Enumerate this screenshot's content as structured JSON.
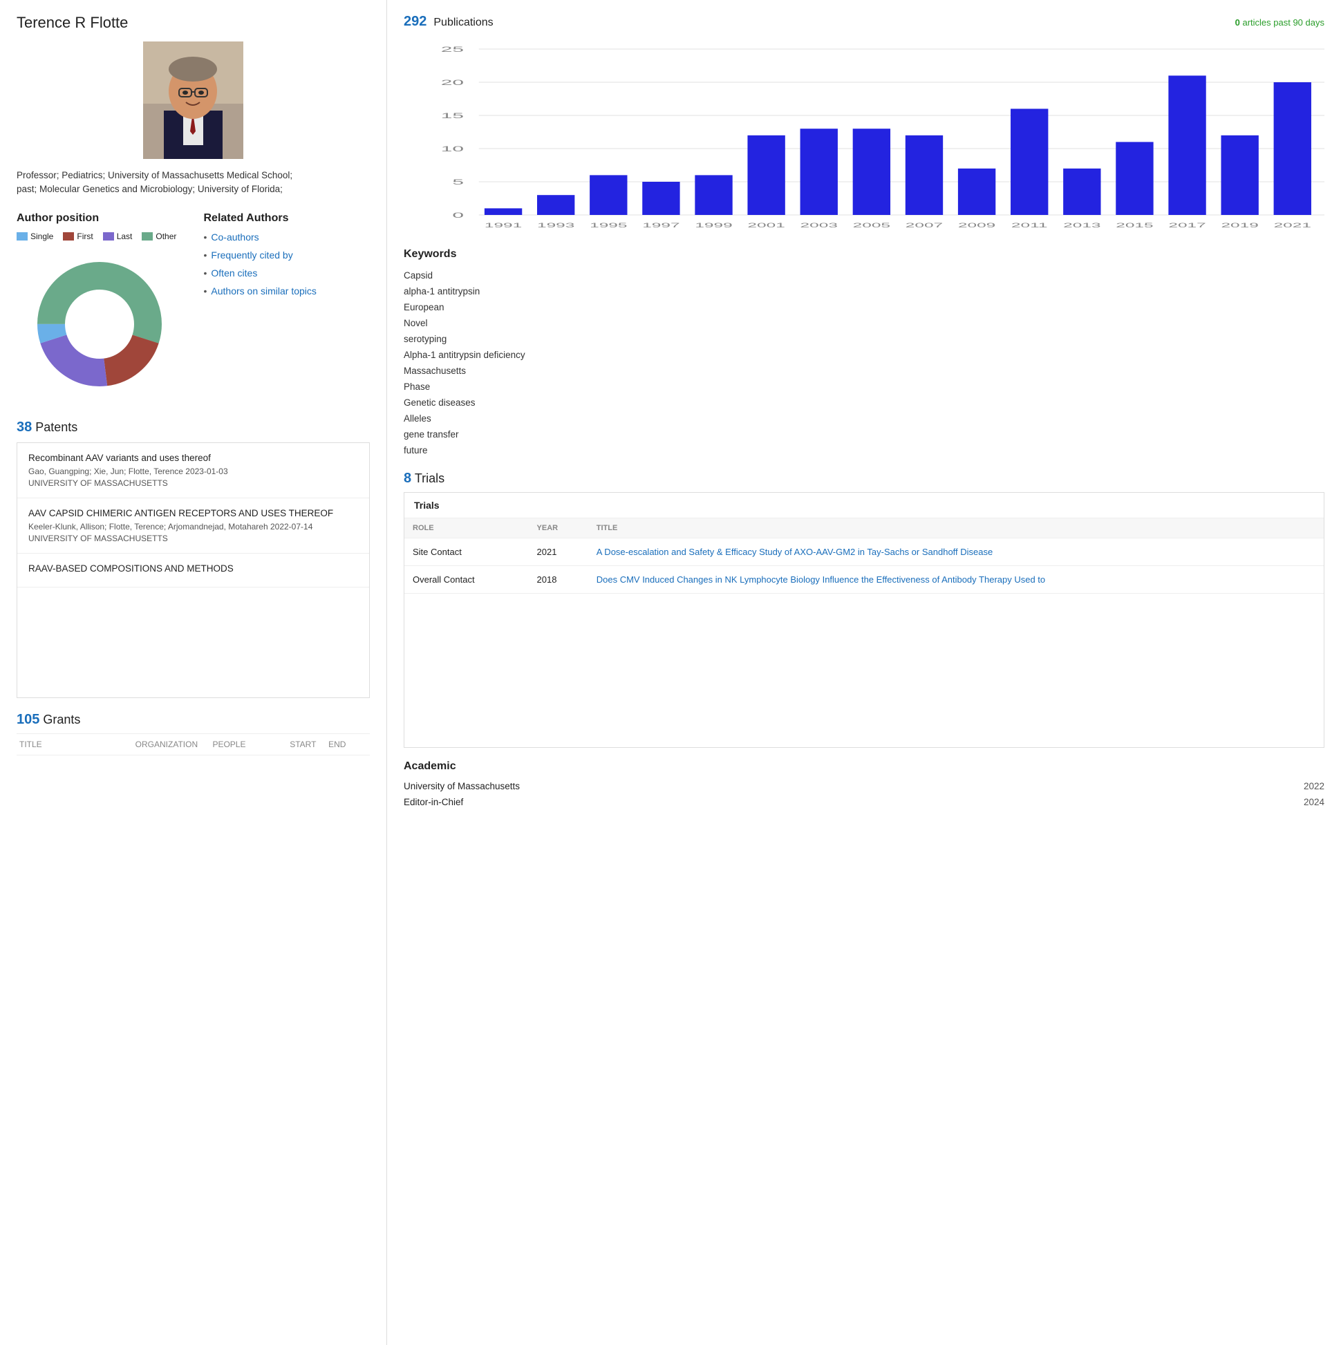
{
  "author": {
    "name": "Terence R Flotte",
    "bio_line1": "Professor; Pediatrics; University of Massachusetts Medical School;",
    "bio_line2": "past; Molecular Genetics and Microbiology; University of Florida;"
  },
  "author_position": {
    "title": "Author position",
    "legend": [
      {
        "label": "Single",
        "color": "#6ab0e8"
      },
      {
        "label": "First",
        "color": "#a0463a"
      },
      {
        "label": "Last",
        "color": "#7b68cc"
      },
      {
        "label": "Other",
        "color": "#6aaa8a"
      }
    ],
    "donut": {
      "segments": [
        {
          "label": "Single",
          "color": "#6ab0e8",
          "percentage": 5
        },
        {
          "label": "First",
          "color": "#a0463a",
          "percentage": 18
        },
        {
          "label": "Last",
          "color": "#7b68cc",
          "percentage": 22
        },
        {
          "label": "Other",
          "color": "#6aaa8a",
          "percentage": 55
        }
      ]
    }
  },
  "related_authors": {
    "title": "Related Authors",
    "links": [
      {
        "label": "Co-authors",
        "url": "#"
      },
      {
        "label": "Frequently cited by",
        "url": "#"
      },
      {
        "label": "Often cites",
        "url": "#"
      },
      {
        "label": "Authors on similar topics",
        "url": "#"
      }
    ]
  },
  "publications": {
    "count": "292",
    "label": "Publications",
    "articles_past_90": "0",
    "articles_past_90_label": "articles past 90 days",
    "chart": {
      "years": [
        "1991",
        "1993",
        "1995",
        "1997",
        "1999",
        "2001",
        "2003",
        "2005",
        "2007",
        "2009",
        "2011",
        "2013",
        "2015",
        "2017",
        "2019",
        "2021"
      ],
      "values": [
        1,
        3,
        6,
        5,
        6,
        12,
        13,
        13,
        12,
        7,
        16,
        7,
        11,
        21,
        12,
        20
      ],
      "y_max": 25,
      "y_ticks": [
        0,
        5,
        10,
        15,
        20,
        25
      ],
      "bar_color": "#2323e0"
    }
  },
  "keywords": {
    "title": "Keywords",
    "items": [
      "Capsid",
      "alpha-1 antitrypsin",
      "European",
      "Novel",
      "serotyping",
      "Alpha-1 antitrypsin deficiency",
      "Massachusetts",
      "Phase",
      "Genetic diseases",
      "Alleles",
      "gene transfer",
      "future"
    ]
  },
  "patents": {
    "count": "38",
    "label": "Patents",
    "items": [
      {
        "title": "Recombinant AAV variants and uses thereof",
        "authors": "Gao, Guangping; Xie, Jun; Flotte, Terence",
        "date": "2023-01-03",
        "org": "UNIVERSITY OF MASSACHUSETTS"
      },
      {
        "title": "AAV CAPSID CHIMERIC ANTIGEN RECEPTORS AND USES THEREOF",
        "authors": "Keeler-Klunk, Allison; Flotte, Terence; Arjomandnejad, Motahareh",
        "date": "2022-07-14",
        "org": "UNIVERSITY OF MASSACHUSETTS"
      },
      {
        "title": "RAAV-BASED COMPOSITIONS AND METHODS",
        "authors": "",
        "date": "",
        "org": ""
      }
    ]
  },
  "grants": {
    "count": "105",
    "label": "Grants",
    "columns": [
      "TITLE",
      "ORGANIZATION",
      "PEOPLE",
      "START",
      "END"
    ]
  },
  "trials": {
    "count": "8",
    "label": "Trials",
    "box_title": "Trials",
    "columns": [
      "ROLE",
      "YEAR",
      "TITLE"
    ],
    "items": [
      {
        "role": "Site Contact",
        "year": "2021",
        "title": "A Dose-escalation and Safety & Efficacy Study of AXO-AAV-GM2 in Tay-Sachs or Sandhoff Disease",
        "url": "#"
      },
      {
        "role": "Overall Contact",
        "year": "2018",
        "title": "Does CMV Induced Changes in NK Lymphocyte Biology Influence the Effectiveness of Antibody Therapy Used to",
        "url": "#"
      }
    ]
  },
  "academic": {
    "title": "Academic",
    "items": [
      {
        "institution": "University of Massachusetts",
        "year": "2022"
      },
      {
        "institution": "Editor-in-Chief",
        "year": "2024"
      }
    ]
  }
}
